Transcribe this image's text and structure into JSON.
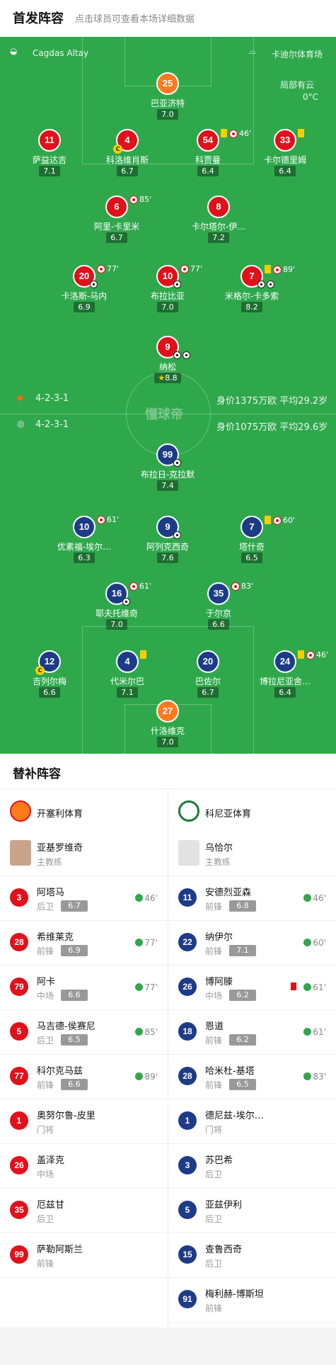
{
  "header": {
    "title": "首发阵容",
    "subtitle": "点击球员可查看本场详细数据"
  },
  "match_info": {
    "referee": "Cagdas Altay",
    "stadium": "卡迪尔体育场",
    "weather": "局部有云",
    "temperature": "0°C"
  },
  "home": {
    "formation": "4-2-3-1",
    "value": "身价1375万欧 平均29.2岁",
    "color": "#e0111b"
  },
  "away": {
    "formation": "4-2-3-1",
    "value": "身价1075万欧 平均29.6岁",
    "color": "#1d3b86"
  },
  "watermark": "懂球帝",
  "home_players": [
    {
      "num": "25",
      "name": "巴亚济特",
      "rating": "7.0"
    },
    {
      "num": "11",
      "name": "萨益达吉",
      "rating": "7.1"
    },
    {
      "num": "4",
      "name": "科洛维肖斯",
      "rating": "6.7"
    },
    {
      "num": "54",
      "name": "科贾曼",
      "rating": "6.4",
      "event": "46'"
    },
    {
      "num": "33",
      "name": "卡尔德里姆",
      "rating": "6.4"
    },
    {
      "num": "6",
      "name": "阿里-卡里米",
      "rating": "6.7",
      "event": "85'"
    },
    {
      "num": "8",
      "name": "卡尔塔尔-伊…",
      "rating": "7.2"
    },
    {
      "num": "20",
      "name": "卡洛斯-马内",
      "rating": "6.9",
      "event": "77'"
    },
    {
      "num": "10",
      "name": "布拉比亚",
      "rating": "7.0",
      "event": "77'"
    },
    {
      "num": "7",
      "name": "米格尔-卡多索",
      "rating": "8.2",
      "event": "89'"
    },
    {
      "num": "9",
      "name": "纳松",
      "rating": "8.8"
    }
  ],
  "away_players": [
    {
      "num": "99",
      "name": "布拉日-克拉默",
      "rating": "7.4"
    },
    {
      "num": "10",
      "name": "优素福-埃尔…",
      "rating": "6.3",
      "event": "61'"
    },
    {
      "num": "9",
      "name": "阿列克西奇",
      "rating": "7.6"
    },
    {
      "num": "7",
      "name": "塔什奇",
      "rating": "6.5",
      "event": "60'"
    },
    {
      "num": "16",
      "name": "耶夫托维奇",
      "rating": "7.0",
      "event": "61'"
    },
    {
      "num": "35",
      "name": "于尔京",
      "rating": "6.6",
      "event": "83'"
    },
    {
      "num": "12",
      "name": "吉列尔梅",
      "rating": "6.6"
    },
    {
      "num": "4",
      "name": "代米尔巴",
      "rating": "7.1"
    },
    {
      "num": "20",
      "name": "巴佐尔",
      "rating": "6.7"
    },
    {
      "num": "24",
      "name": "博拉尼亚舍…",
      "rating": "6.4",
      "event": "46'"
    },
    {
      "num": "27",
      "name": "什洛维克",
      "rating": "7.0"
    }
  ],
  "bench": {
    "title": "替补阵容",
    "home_team": "开塞利体育",
    "away_team": "科尼亚体育",
    "home_coach": {
      "name": "亚基罗维奇",
      "role": "主教练"
    },
    "away_coach": {
      "name": "乌恰尔",
      "role": "主教练"
    },
    "home_subs": [
      {
        "num": "3",
        "name": "阿塔马",
        "pos": "后卫",
        "rating": "6.7",
        "time": "46'"
      },
      {
        "num": "28",
        "name": "希维莱克",
        "pos": "前锋",
        "rating": "6.9",
        "time": "77'"
      },
      {
        "num": "79",
        "name": "阿卡",
        "pos": "中场",
        "rating": "6.6",
        "time": "77'"
      },
      {
        "num": "5",
        "name": "马吉德-侯赛尼",
        "pos": "后卫",
        "rating": "6.5",
        "time": "85'"
      },
      {
        "num": "77",
        "name": "科尔克马兹",
        "pos": "前锋",
        "rating": "6.6",
        "time": "89'"
      },
      {
        "num": "1",
        "name": "奥努尔鲁-皮里",
        "pos": "门将",
        "rating": "",
        "time": ""
      },
      {
        "num": "26",
        "name": "盖泽克",
        "pos": "中场",
        "rating": "",
        "time": ""
      },
      {
        "num": "35",
        "name": "厄兹甘",
        "pos": "后卫",
        "rating": "",
        "time": ""
      },
      {
        "num": "99",
        "name": "萨勒阿斯兰",
        "pos": "前锋",
        "rating": "",
        "time": ""
      }
    ],
    "away_subs": [
      {
        "num": "11",
        "name": "安德烈亚森",
        "pos": "前锋",
        "rating": "6.8",
        "time": "46'"
      },
      {
        "num": "22",
        "name": "纳伊尔",
        "pos": "前锋",
        "rating": "7.1",
        "time": "60'"
      },
      {
        "num": "26",
        "name": "博阿滕",
        "pos": "中场",
        "rating": "6.2",
        "time": "61'"
      },
      {
        "num": "18",
        "name": "恩道",
        "pos": "前锋",
        "rating": "6.2",
        "time": "61'"
      },
      {
        "num": "28",
        "name": "哈米杜-基塔",
        "pos": "前锋",
        "rating": "6.5",
        "time": "83'"
      },
      {
        "num": "1",
        "name": "德尼兹-埃尔…",
        "pos": "门将",
        "rating": "",
        "time": ""
      },
      {
        "num": "3",
        "name": "苏巴希",
        "pos": "后卫",
        "rating": "",
        "time": ""
      },
      {
        "num": "5",
        "name": "亚兹伊利",
        "pos": "后卫",
        "rating": "",
        "time": ""
      },
      {
        "num": "15",
        "name": "查鲁西奇",
        "pos": "后卫",
        "rating": "",
        "time": ""
      },
      {
        "num": "91",
        "name": "梅利赫-博斯坦",
        "pos": "前锋",
        "rating": "",
        "time": ""
      }
    ]
  }
}
